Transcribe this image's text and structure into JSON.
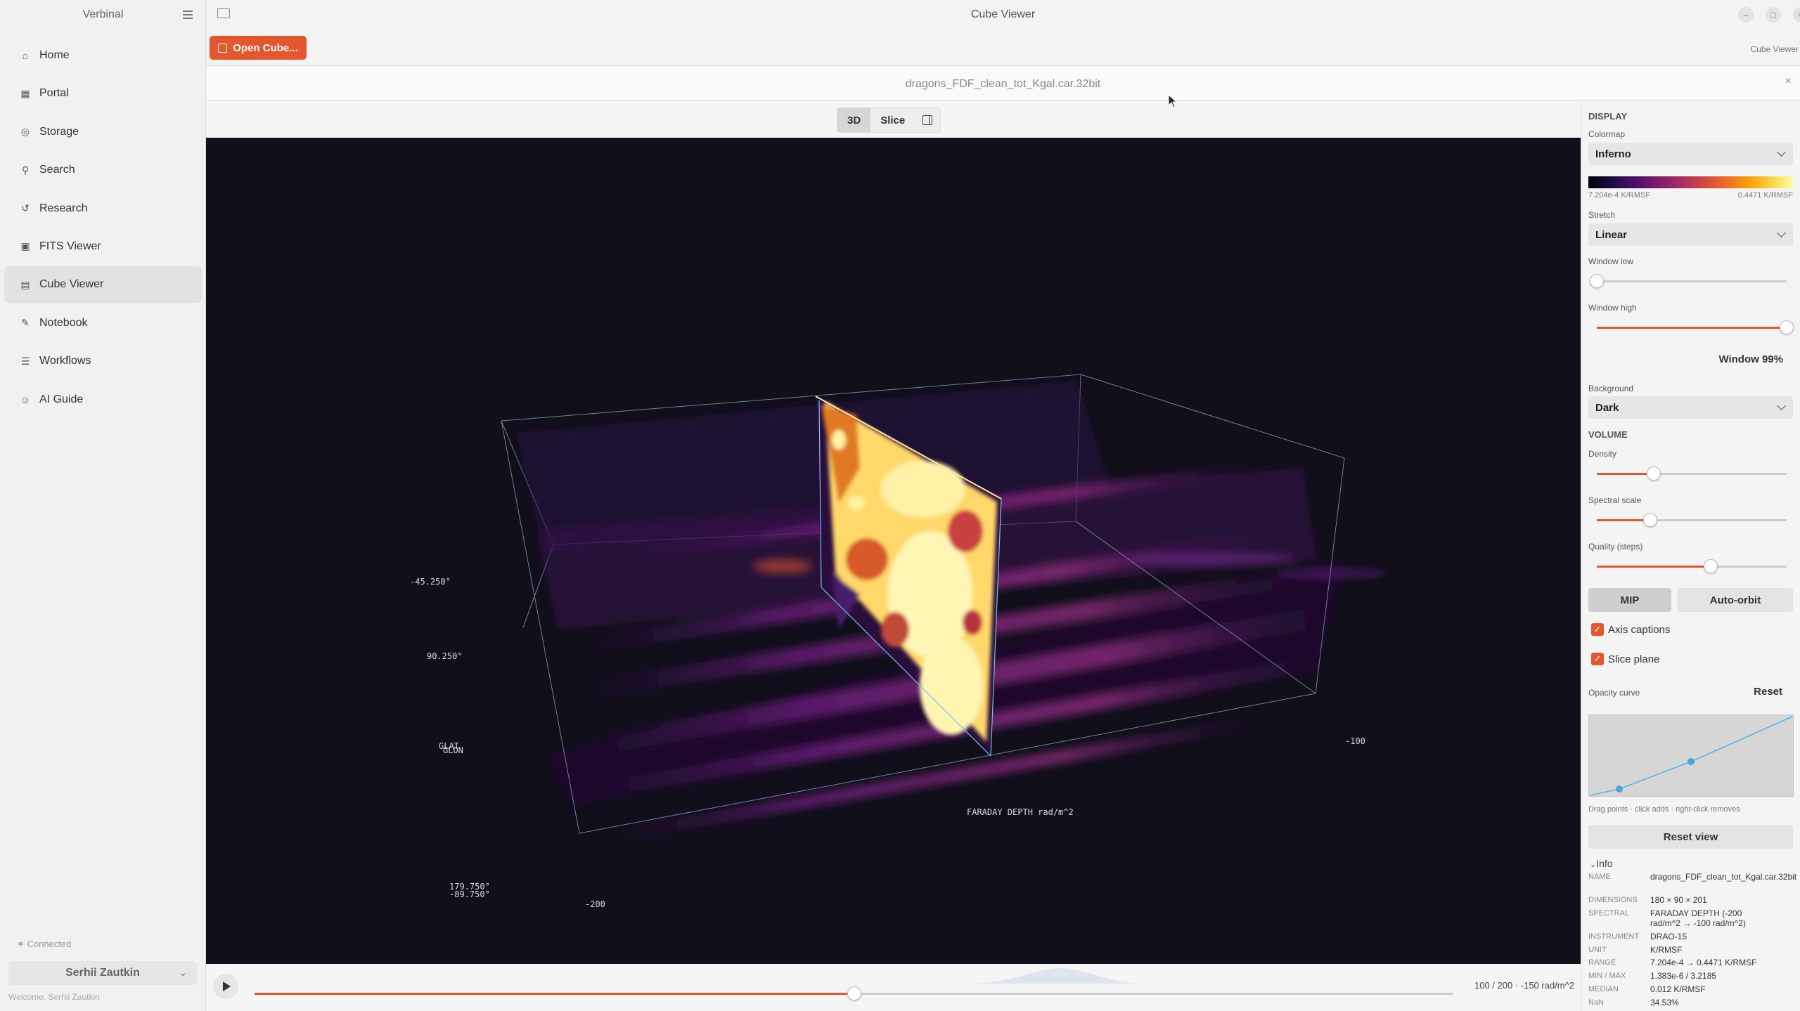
{
  "sidebar": {
    "brand": "Verbinal",
    "items": [
      {
        "label": "Home",
        "icon": "home-icon"
      },
      {
        "label": "Portal",
        "icon": "grid-icon"
      },
      {
        "label": "Storage",
        "icon": "storage-icon"
      },
      {
        "label": "Search",
        "icon": "search-icon"
      },
      {
        "label": "Research",
        "icon": "history-icon"
      },
      {
        "label": "FITS Viewer",
        "icon": "image-icon"
      },
      {
        "label": "Cube Viewer",
        "icon": "cube-icon",
        "active": true
      },
      {
        "label": "Notebook",
        "icon": "notebook-icon"
      },
      {
        "label": "Workflows",
        "icon": "list-icon"
      },
      {
        "label": "AI Guide",
        "icon": "robot-icon"
      }
    ],
    "status": "Connected",
    "user": "Serhii Zautkin",
    "welcome": "Welcome, Serhii Zautkin"
  },
  "window": {
    "title": "Cube Viewer",
    "open_button": "Open Cube...",
    "toolbar_right": "Cube Viewer",
    "file_name": "dragons_FDF_clean_tot_Kgal.car.32bit",
    "close_label": "×",
    "controls": [
      "–",
      "□",
      "×"
    ]
  },
  "view_modes": {
    "mode_3d": "3D",
    "mode_slice": "Slice"
  },
  "viewport": {
    "colors": {
      "box_edge": "#8fa6c8",
      "slice_edge": "#6fc6e8",
      "background": "#100f1a"
    },
    "labels": {
      "dec_top": "-45.250°",
      "l_mid": "90.250°",
      "glat": "GLAT",
      "glon": "GLON",
      "l_low": "179.750°",
      "b_low": "-89.750°",
      "fd_low": "-200",
      "fd_high": "-100",
      "fd_axis": "FARADAY DEPTH rad/m^2"
    }
  },
  "timeline": {
    "readout": "100 / 200 · -150 rad/m^2",
    "position_fraction": 0.5
  },
  "panel": {
    "display_head": "DISPLAY",
    "colormap_label": "Colormap",
    "colormap_value": "Inferno",
    "cmap_min": "7.204e-4 K/RMSF",
    "cmap_max": "0.4471 K/RMSF",
    "stretch_label": "Stretch",
    "stretch_value": "Linear",
    "window_low_label": "Window low",
    "window_low": 0.0,
    "window_high_label": "Window high",
    "window_high": 1.0,
    "window_readout": "Window 99%",
    "background_label": "Background",
    "background_value": "Dark",
    "volume_head": "VOLUME",
    "density_label": "Density",
    "density": 0.3,
    "spectral_label": "Spectral scale",
    "spectral": 0.28,
    "quality_label": "Quality (steps)",
    "quality": 0.6,
    "mip_label": "MIP",
    "autoorbit_label": "Auto-orbit",
    "axis_captions_label": "Axis captions",
    "slice_plane_label": "Slice plane",
    "opacity_label": "Opacity curve",
    "reset_label": "Reset",
    "opacity_hint": "Drag points · click adds · right-click removes",
    "reset_view_label": "Reset view",
    "info_head": "Info",
    "info": [
      {
        "k": "NAME",
        "v": "dragons_FDF_clean_tot_Kgal.car.32bit"
      },
      {
        "k": "DIMENSIONS",
        "v": "180 × 90 × 201"
      },
      {
        "k": "SPECTRAL",
        "v": "FARADAY DEPTH (-200 rad/m^2 → -100 rad/m^2)"
      },
      {
        "k": "INSTRUMENT",
        "v": "DRAO-15"
      },
      {
        "k": "UNIT",
        "v": "K/RMSF"
      },
      {
        "k": "RANGE",
        "v": "7.204e-4 → 0.4471 K/RMSF"
      },
      {
        "k": "MIN / MAX",
        "v": "1.383e-6 / 3.2185"
      },
      {
        "k": "MEDIAN",
        "v": "0.012 K/RMSF"
      },
      {
        "k": "NaN",
        "v": "34.53%"
      }
    ]
  }
}
